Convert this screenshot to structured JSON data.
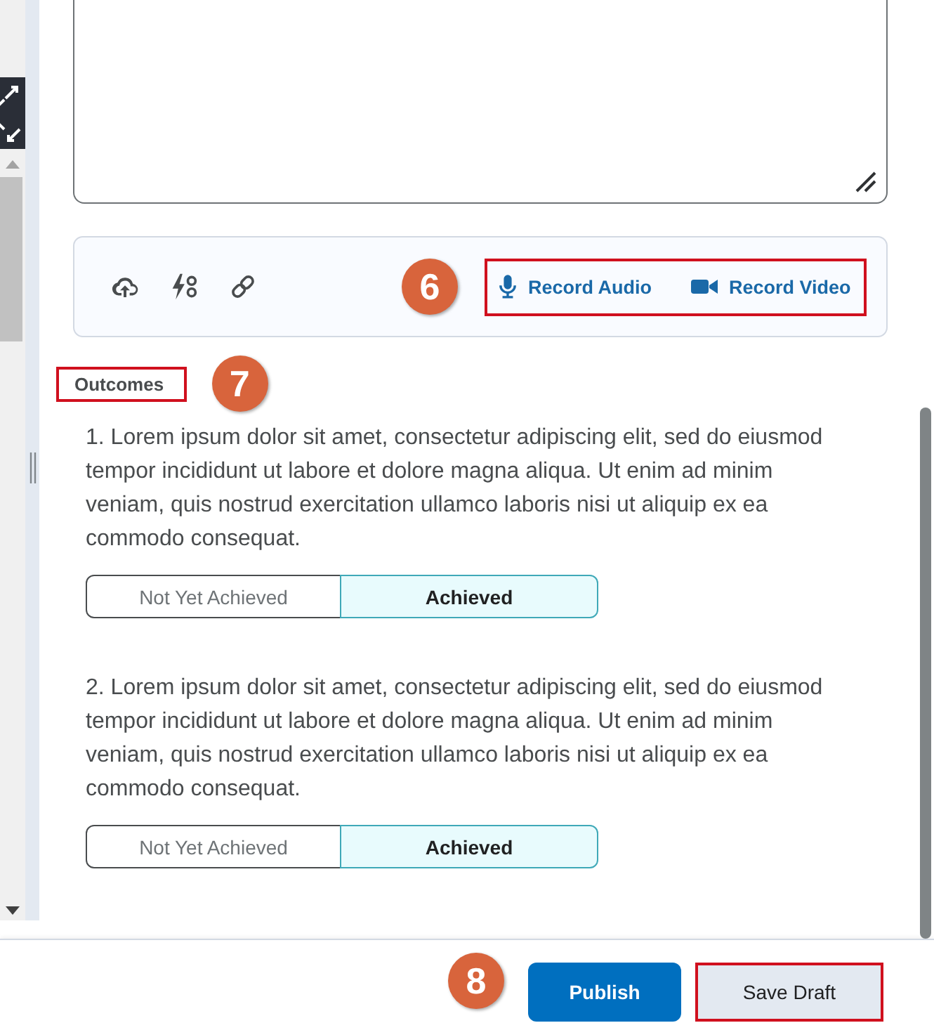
{
  "attachment_bar": {
    "callout": "6",
    "record_highlighted": true,
    "record_buttons": [
      {
        "kind": "audio",
        "label": "Record Audio"
      },
      {
        "kind": "video",
        "label": "Record Video"
      }
    ]
  },
  "outcomes": {
    "heading": "Outcomes",
    "heading_highlighted": true,
    "callout": "7",
    "items": [
      {
        "text": "1. Lorem ipsum dolor sit amet, consectetur adipiscing elit, sed do eiusmod tempor incididunt ut labore et dolore magna aliqua. Ut enim ad minim veniam, quis nostrud exercitation ullamco laboris nisi ut aliquip ex ea commodo consequat.",
        "options": [
          {
            "label": "Not Yet Achieved",
            "selected": false
          },
          {
            "label": "Achieved",
            "selected": true
          }
        ]
      },
      {
        "text": "2. Lorem ipsum dolor sit amet, consectetur adipiscing elit, sed do eiusmod tempor incididunt ut labore et dolore magna aliqua. Ut enim ad minim veniam, quis nostrud exercitation ullamco laboris nisi ut aliquip ex ea commodo consequat.",
        "options": [
          {
            "label": "Not Yet Achieved",
            "selected": false
          },
          {
            "label": "Achieved",
            "selected": true
          }
        ]
      }
    ]
  },
  "footer": {
    "callout": "8",
    "buttons": [
      {
        "kind": "primary",
        "label": "Publish",
        "highlighted": false
      },
      {
        "kind": "secondary",
        "label": "Save Draft",
        "highlighted": true
      }
    ]
  }
}
